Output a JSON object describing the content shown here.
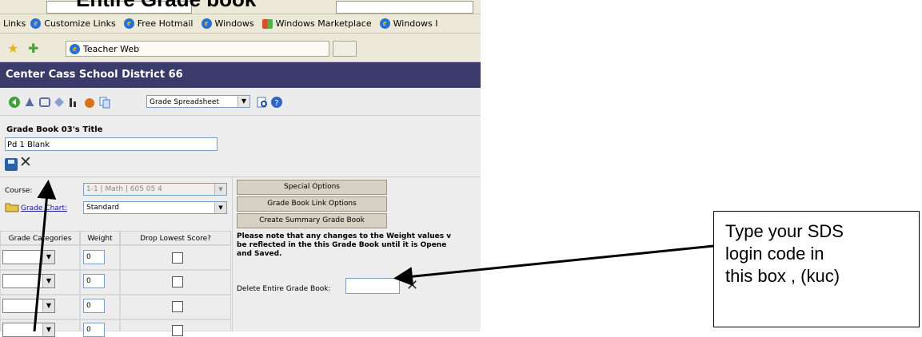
{
  "slide": {
    "heading": "Entire Grade book"
  },
  "browser": {
    "links_bar": {
      "label": "Links",
      "items": [
        "Customize Links",
        "Free Hotmail",
        "Windows",
        "Windows Marketplace",
        "Windows I"
      ]
    },
    "tab_title": "Teacher Web"
  },
  "page": {
    "district_name": "Center Cass School District 66",
    "toolbar": {
      "view_select": "Grade Spreadsheet"
    },
    "title_label": "Grade Book 03's Title",
    "title_value": "Pd 1 Blank",
    "course": {
      "label": "Course:",
      "value": "1-1 | Math | 605 05 4"
    },
    "grade_chart": {
      "label": "Grade Chart:",
      "value": "Standard"
    },
    "categories_table": {
      "headers": [
        "Grade Categories",
        "Weight",
        "Drop Lowest Score?"
      ],
      "rows": [
        {
          "category": "",
          "weight": "0",
          "drop_lowest": false
        },
        {
          "category": "",
          "weight": "0",
          "drop_lowest": false
        },
        {
          "category": "",
          "weight": "0",
          "drop_lowest": false
        },
        {
          "category": "",
          "weight": "0",
          "drop_lowest": false
        }
      ]
    },
    "option_buttons": [
      "Special Options",
      "Grade Book Link Options",
      "Create Summary Grade Book"
    ],
    "note_lines": [
      "Please note that any changes to the Weight values v",
      "be reflected in the this Grade Book until it is Opene",
      "and Saved."
    ],
    "delete_label": "Delete Entire Grade Book:",
    "delete_value": ""
  },
  "callout": {
    "lines": [
      "Type your SDS",
      "login code in",
      "this box , (kuc)"
    ]
  }
}
